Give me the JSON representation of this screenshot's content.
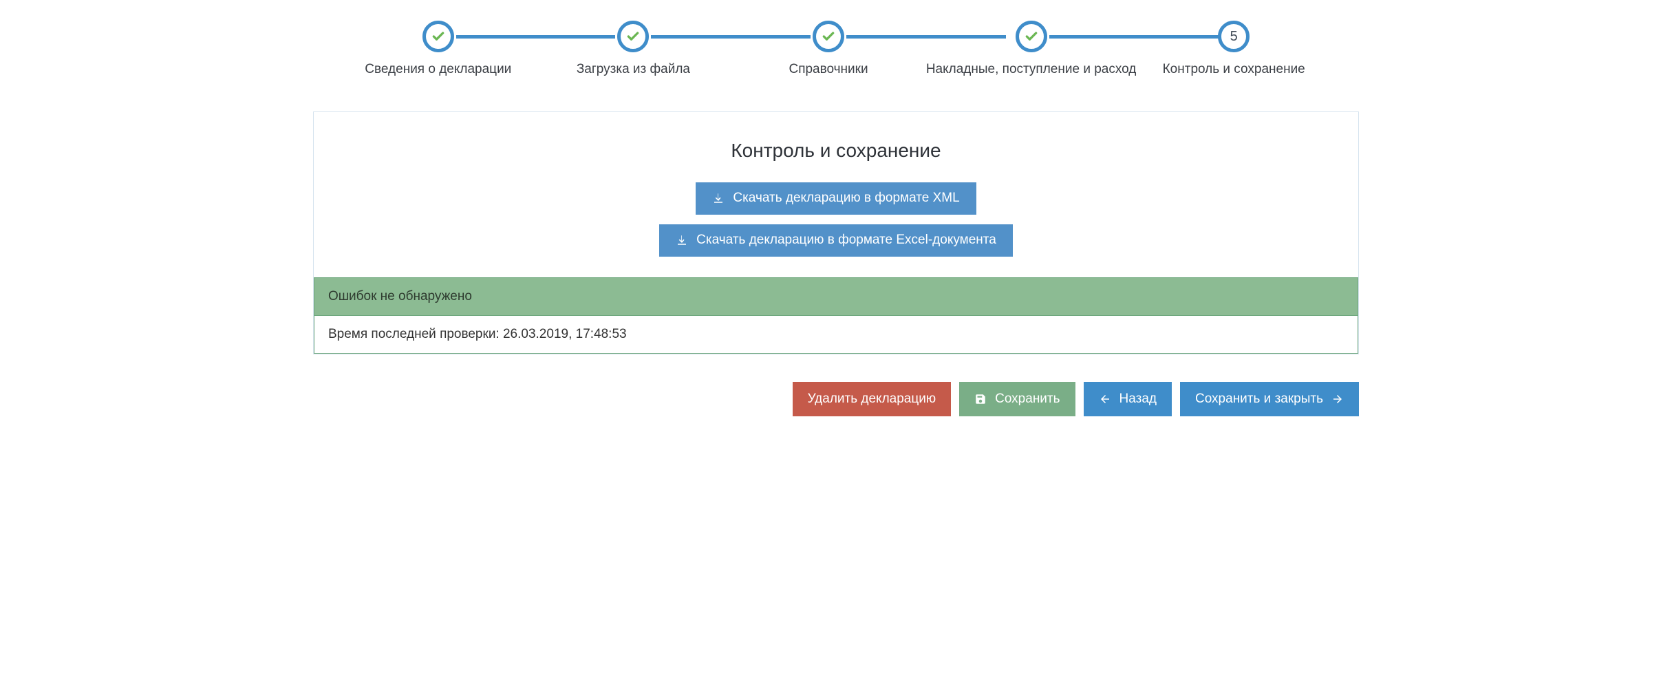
{
  "stepper": {
    "steps": [
      {
        "label": "Сведения о декларации",
        "done": true
      },
      {
        "label": "Загрузка из файла",
        "done": true
      },
      {
        "label": "Справочники",
        "done": true
      },
      {
        "label": "Накладные, поступление и расход",
        "done": true
      },
      {
        "label": "Контроль и сохранение",
        "done": false,
        "number": "5"
      }
    ]
  },
  "panel": {
    "title": "Контроль и сохранение",
    "download_xml": "Скачать декларацию в формате XML",
    "download_excel": "Скачать декларацию в формате Excel-документа",
    "status_heading": "Ошибок не обнаружено",
    "last_check": "Время последней проверки: 26.03.2019, 17:48:53"
  },
  "actions": {
    "delete": "Удалить декларацию",
    "save": "Сохранить",
    "back": "Назад",
    "save_close": "Сохранить и закрыть"
  }
}
